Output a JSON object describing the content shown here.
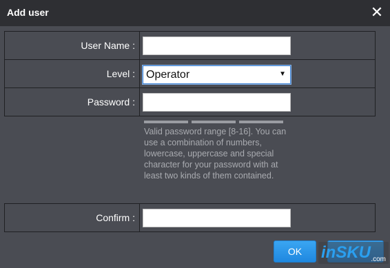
{
  "dialog": {
    "title": "Add user",
    "close_glyph": "✕"
  },
  "form": {
    "username_label": "User Name :",
    "username_value": "",
    "level_label": "Level :",
    "level_value": "Operator",
    "password_label": "Password :",
    "password_value": "",
    "password_hint": "Valid password range [8-16]. You can use a combination of numbers, lowercase, uppercase and special character for your password with at least two kinds of them contained.",
    "confirm_label": "Confirm :",
    "confirm_value": ""
  },
  "buttons": {
    "ok_label": "OK"
  },
  "watermark": {
    "brand": "inSKU",
    "domain": ".com"
  },
  "colors": {
    "dialog_bg": "#4a4c53",
    "titlebar_bg": "#2e2f33",
    "button_blue": "#2a95e8",
    "hint_text": "#a9abb0"
  },
  "icons": {
    "close": "close-icon",
    "dropdown": "chevron-down-icon"
  }
}
